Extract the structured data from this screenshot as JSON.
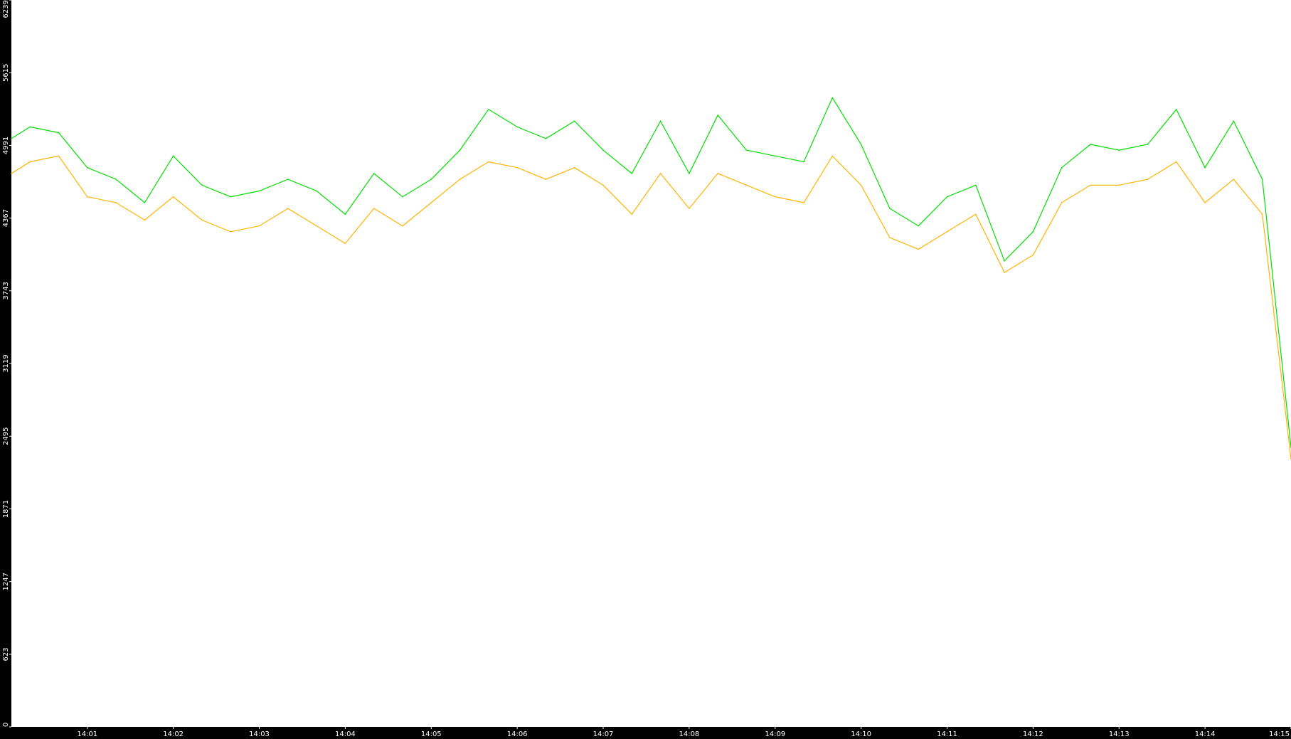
{
  "chart_data": {
    "type": "line",
    "title": "",
    "xlabel": "",
    "ylabel": "",
    "grid": false,
    "legend": "none",
    "background_color": "#000000",
    "plot_color": "#ffffff",
    "axis_text_color": "#ffffff",
    "y_axis": {
      "min": 0,
      "max": 6239,
      "ticks": [
        0,
        623,
        1247,
        1871,
        2495,
        3119,
        3743,
        4367,
        4991,
        5615,
        6239
      ]
    },
    "x_axis": {
      "start_time": "14:00:07",
      "end_time": "14:15:00",
      "ticks": [
        "14:01",
        "14:02",
        "14:03",
        "14:04",
        "14:05",
        "14:06",
        "14:07",
        "14:08",
        "14:09",
        "14:10",
        "14:11",
        "14:12",
        "14:13",
        "14:14",
        "14:15"
      ]
    },
    "series": [
      {
        "color": "#00e000",
        "x": [
          "14:00:07",
          "14:00:20",
          "14:00:40",
          "14:01:00",
          "14:01:20",
          "14:01:40",
          "14:02:00",
          "14:02:20",
          "14:02:40",
          "14:03:00",
          "14:03:20",
          "14:03:40",
          "14:04:00",
          "14:04:20",
          "14:04:40",
          "14:05:00",
          "14:05:20",
          "14:05:40",
          "14:06:00",
          "14:06:20",
          "14:06:40",
          "14:07:00",
          "14:07:20",
          "14:07:40",
          "14:08:00",
          "14:08:20",
          "14:08:40",
          "14:09:00",
          "14:09:20",
          "14:09:40",
          "14:10:00",
          "14:10:20",
          "14:10:40",
          "14:11:00",
          "14:11:20",
          "14:11:40",
          "14:12:00",
          "14:12:20",
          "14:12:40",
          "14:13:00",
          "14:13:20",
          "14:13:40",
          "14:14:00",
          "14:14:20",
          "14:14:40",
          "14:15:00"
        ],
        "values": [
          5050,
          5150,
          5100,
          4800,
          4700,
          4500,
          4900,
          4650,
          4550,
          4600,
          4700,
          4600,
          4400,
          4750,
          4550,
          4700,
          4950,
          5300,
          5150,
          5050,
          5200,
          4950,
          4750,
          5200,
          4750,
          5250,
          4950,
          4900,
          4850,
          5400,
          5000,
          4450,
          4300,
          4550,
          4650,
          4000,
          4250,
          4800,
          5000,
          4950,
          5000,
          5300,
          4800,
          5200,
          4700,
          2400
        ]
      },
      {
        "color": "#ffb400",
        "x": [
          "14:00:07",
          "14:00:20",
          "14:00:40",
          "14:01:00",
          "14:01:20",
          "14:01:40",
          "14:02:00",
          "14:02:20",
          "14:02:40",
          "14:03:00",
          "14:03:20",
          "14:03:40",
          "14:04:00",
          "14:04:20",
          "14:04:40",
          "14:05:00",
          "14:05:20",
          "14:05:40",
          "14:06:00",
          "14:06:20",
          "14:06:40",
          "14:07:00",
          "14:07:20",
          "14:07:40",
          "14:08:00",
          "14:08:20",
          "14:08:40",
          "14:09:00",
          "14:09:20",
          "14:09:40",
          "14:10:00",
          "14:10:20",
          "14:10:40",
          "14:11:00",
          "14:11:20",
          "14:11:40",
          "14:12:00",
          "14:12:20",
          "14:12:40",
          "14:13:00",
          "14:13:20",
          "14:13:40",
          "14:14:00",
          "14:14:20",
          "14:14:40",
          "14:15:00"
        ],
        "values": [
          4750,
          4850,
          4900,
          4550,
          4500,
          4350,
          4550,
          4350,
          4250,
          4300,
          4450,
          4300,
          4150,
          4450,
          4300,
          4500,
          4700,
          4850,
          4800,
          4700,
          4800,
          4650,
          4400,
          4750,
          4450,
          4750,
          4650,
          4550,
          4500,
          4900,
          4650,
          4200,
          4100,
          4250,
          4400,
          3900,
          4050,
          4500,
          4650,
          4650,
          4700,
          4850,
          4500,
          4700,
          4400,
          2300
        ]
      }
    ]
  }
}
